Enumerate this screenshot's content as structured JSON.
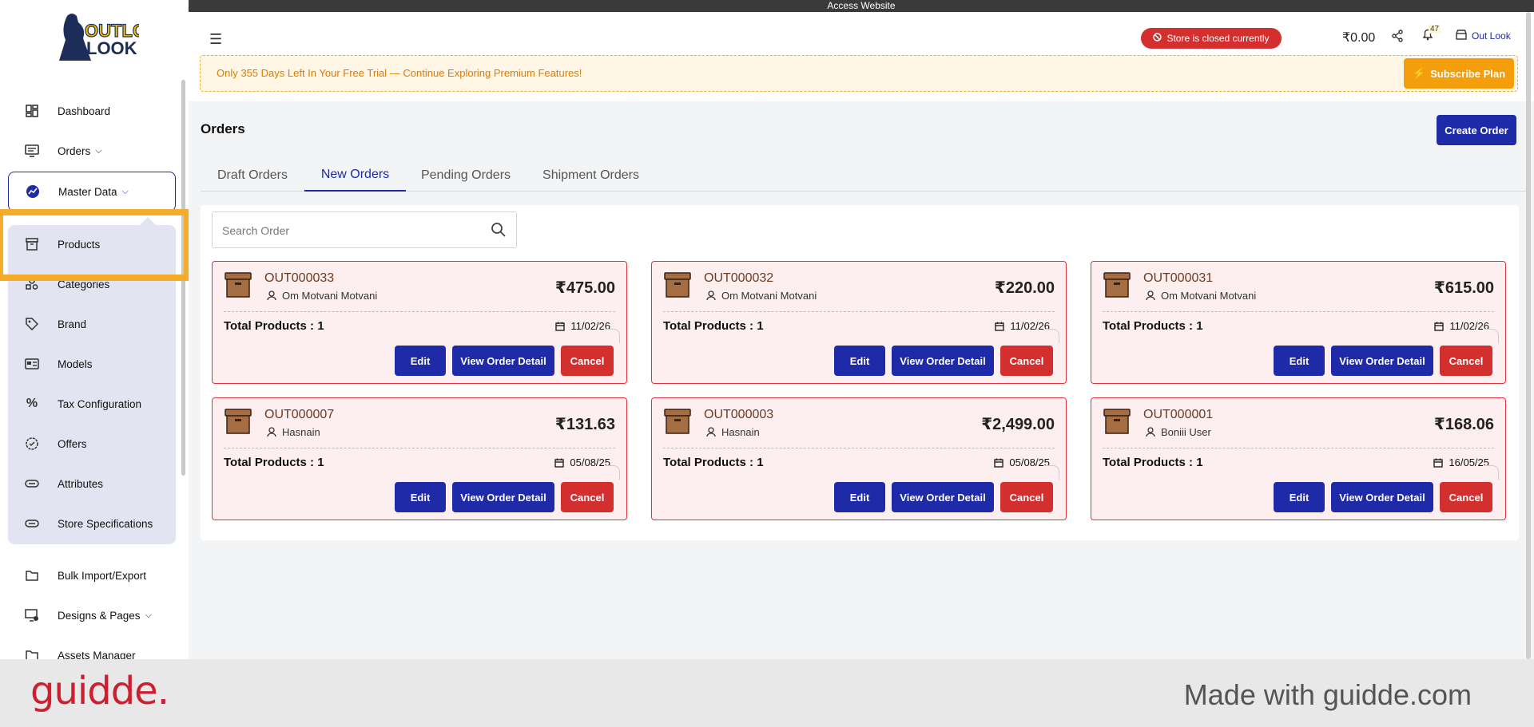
{
  "topbar": {
    "label": "Access Website"
  },
  "brand": {
    "logo_text": "OUTLOOK"
  },
  "sidebar": {
    "items": [
      {
        "label": "Dashboard",
        "icon": "dashboard-icon"
      },
      {
        "label": "Orders",
        "icon": "orders-icon",
        "has_chevron": true
      },
      {
        "label": "Master Data",
        "icon": "chart-icon",
        "has_chevron": true,
        "active": true
      }
    ],
    "submenu": [
      {
        "label": "Products",
        "icon": "archive-icon"
      },
      {
        "label": "Categories",
        "icon": "categories-icon"
      },
      {
        "label": "Brand",
        "icon": "tag-icon"
      },
      {
        "label": "Models",
        "icon": "models-icon"
      },
      {
        "label": "Tax Configuration",
        "icon": "percent-icon"
      },
      {
        "label": "Offers",
        "icon": "badge-icon"
      },
      {
        "label": "Attributes",
        "icon": "attributes-icon"
      },
      {
        "label": "Store Specifications",
        "icon": "specs-icon"
      }
    ],
    "more_items": [
      {
        "label": "Bulk Import/Export",
        "icon": "folder-icon"
      },
      {
        "label": "Designs & Pages",
        "icon": "designs-icon",
        "has_chevron": true
      },
      {
        "label": "Assets Manager",
        "icon": "assets-icon"
      }
    ]
  },
  "header": {
    "store_status": "Store is closed currently",
    "balance": "₹0.00",
    "notification_count": "47",
    "store_name": "Out Look",
    "trial_message": "Only 355 Days Left In Your Free Trial — Continue Exploring Premium Features!",
    "subscribe_label": "Subscribe Plan"
  },
  "page": {
    "title": "Orders",
    "create_label": "Create Order",
    "tabs": [
      "Draft Orders",
      "New Orders",
      "Pending Orders",
      "Shipment Orders"
    ],
    "active_tab": "New Orders",
    "search_placeholder": "Search Order"
  },
  "orders": [
    {
      "id": "OUT000033",
      "customer": "Om Motvani Motvani",
      "amount": "₹475.00",
      "total_products": "Total Products : 1",
      "date": "11/02/26"
    },
    {
      "id": "OUT000032",
      "customer": "Om Motvani Motvani",
      "amount": "₹220.00",
      "total_products": "Total Products : 1",
      "date": "11/02/26"
    },
    {
      "id": "OUT000031",
      "customer": "Om Motvani Motvani",
      "amount": "₹615.00",
      "total_products": "Total Products : 1",
      "date": "11/02/26"
    },
    {
      "id": "OUT000007",
      "customer": "Hasnain",
      "amount": "₹131.63",
      "total_products": "Total Products : 1",
      "date": "05/08/25"
    },
    {
      "id": "OUT000003",
      "customer": "Hasnain",
      "amount": "₹2,499.00",
      "total_products": "Total Products : 1",
      "date": "05/08/25"
    },
    {
      "id": "OUT000001",
      "customer": "Boniii User",
      "amount": "₹168.06",
      "total_products": "Total Products : 1",
      "date": "16/05/25"
    }
  ],
  "card_actions": {
    "edit": "Edit",
    "view": "View Order Detail",
    "cancel": "Cancel"
  },
  "footer": {
    "logo": "guidde.",
    "made_with": "Made with guidde.com"
  },
  "colors": {
    "primary": "#1e2aa8",
    "danger": "#d32f2f",
    "warning": "#f59e0b",
    "highlight": "#f5ac2a"
  }
}
